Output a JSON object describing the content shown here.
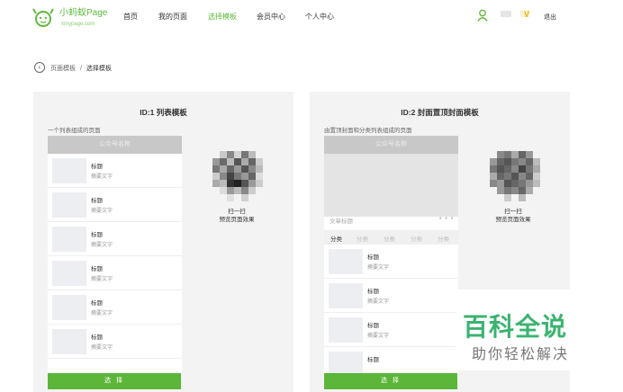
{
  "header": {
    "logo_text": "小蚂蚁Page",
    "logo_sub": "xmypage.com",
    "nav": [
      "首页",
      "我的页面",
      "选择模板",
      "会员中心",
      "个人中心"
    ],
    "vip": "V",
    "logout": "退出",
    "accent": "#5fb83d"
  },
  "breadcrumb": {
    "parent": "页面模板",
    "sep": "/",
    "current": "选择模板"
  },
  "cards": [
    {
      "title": "ID:1 列表模板",
      "desc": "一个列表组成的页面",
      "phone_header": "公众号名称",
      "items": [
        {
          "title": "标题",
          "summary": "摘要文字"
        },
        {
          "title": "标题",
          "summary": "摘要文字"
        },
        {
          "title": "标题",
          "summary": "摘要文字"
        },
        {
          "title": "标题",
          "summary": "摘要文字"
        },
        {
          "title": "标题",
          "summary": "摘要文字"
        },
        {
          "title": "标题",
          "summary": "摘要文字"
        }
      ],
      "qr_line1": "扫一扫",
      "qr_line2": "预览页面效果",
      "button": "选 择"
    },
    {
      "title": "ID:2 封面置顶封面模板",
      "desc": "由置顶封面和分类列表组成的页面",
      "phone_header": "公众号名称",
      "cover_title": "文章标题",
      "cover_dots": "• • •",
      "categories": [
        "分类",
        "分类",
        "分类",
        "分类",
        "分类"
      ],
      "items": [
        {
          "title": "标题",
          "summary": "摘要文字"
        },
        {
          "title": "标题",
          "summary": "摘要文字"
        },
        {
          "title": "标题",
          "summary": "摘要文字"
        },
        {
          "title": "标题",
          "summary": ""
        }
      ],
      "qr_line1": "扫一扫",
      "qr_line2": "预览页面效果",
      "button": "选 择"
    }
  ],
  "watermark": {
    "main": "百科全说",
    "sub": "助你轻松解决"
  }
}
